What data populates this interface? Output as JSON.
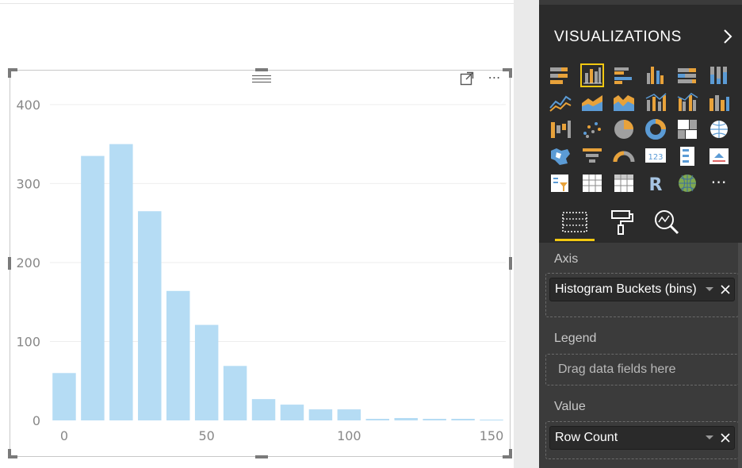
{
  "pane": {
    "title": "VISUALIZATIONS",
    "wells": {
      "axis": {
        "label": "Axis",
        "field": "Histogram Buckets (bins)"
      },
      "legend": {
        "label": "Legend",
        "placeholder": "Drag data fields here"
      },
      "value": {
        "label": "Value",
        "field": "Row Count"
      }
    },
    "tabs": [
      "fields-tab",
      "format-tab",
      "analytics-tab"
    ],
    "gallery_more": "⋯",
    "accent_color": "#f2c811"
  },
  "visual": {
    "more_options": "⋯"
  },
  "chart_data": {
    "type": "bar",
    "title": "",
    "xlabel": "",
    "ylabel": "",
    "x": [
      0,
      10,
      20,
      30,
      40,
      50,
      60,
      70,
      80,
      90,
      100,
      110,
      120,
      130,
      140,
      150
    ],
    "values": [
      60,
      335,
      350,
      265,
      164,
      121,
      69,
      27,
      20,
      14,
      14,
      2,
      3,
      2,
      2,
      1
    ],
    "xticks": [
      "0",
      "50",
      "100",
      "150"
    ],
    "yticks": [
      "0",
      "100",
      "200",
      "300",
      "400"
    ],
    "ylim": [
      0,
      420
    ],
    "bar_color": "#b5dcf4",
    "grid": true
  }
}
